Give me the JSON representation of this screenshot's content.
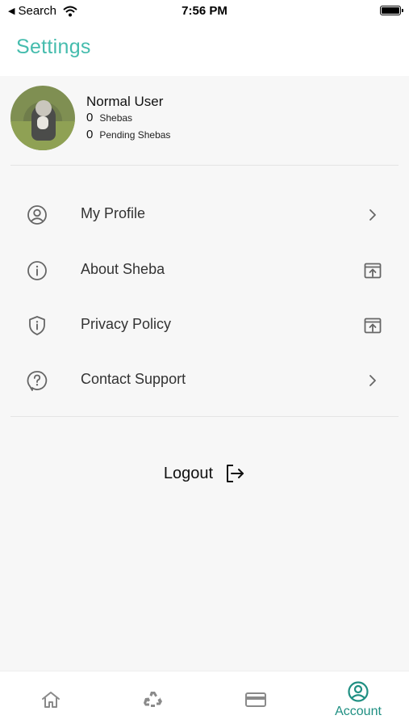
{
  "status_bar": {
    "back_label": "Search",
    "time": "7:56 PM"
  },
  "header": {
    "title": "Settings"
  },
  "profile": {
    "name": "Normal User",
    "shebas_count": "0",
    "shebas_label": "Shebas",
    "pending_count": "0",
    "pending_label": "Pending Shebas"
  },
  "menu": {
    "items": [
      {
        "label": "My Profile",
        "icon": "user-circle-icon",
        "trailing": "chevron-right-icon"
      },
      {
        "label": "About Sheba",
        "icon": "info-circle-icon",
        "trailing": "external-link-icon"
      },
      {
        "label": "Privacy Policy",
        "icon": "shield-info-icon",
        "trailing": "external-link-icon"
      },
      {
        "label": "Contact Support",
        "icon": "help-circle-icon",
        "trailing": "chevron-right-icon"
      }
    ]
  },
  "logout": {
    "label": "Logout",
    "icon": "logout-icon"
  },
  "tabbar": {
    "tabs": [
      {
        "icon": "home-icon",
        "label": ""
      },
      {
        "icon": "recycle-icon",
        "label": ""
      },
      {
        "icon": "card-icon",
        "label": ""
      },
      {
        "icon": "account-icon",
        "label": "Account",
        "active": true
      }
    ]
  },
  "colors": {
    "accent": "#45bcad",
    "active_tab": "#1f8f82",
    "icon_gray": "#666666",
    "inactive_tab": "#8a8a8a"
  }
}
